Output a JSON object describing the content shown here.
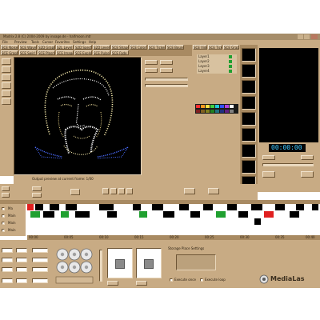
{
  "window": {
    "title": "Madrix 2.8 (C) 2004-2009 by inoage.de - halfmoon.mtr"
  },
  "menu": [
    "File",
    "Preview",
    "Tools",
    "Cursor",
    "Favorites",
    "Settings",
    "Help"
  ],
  "effect_tabs": [
    "SCE Noise",
    "SCE Wave",
    "S2D Graph",
    "S2L Level",
    "S2D Spectrum",
    "S2D Level",
    "SCE Shapes",
    "SCE Color",
    "SCE Ticker",
    "SCE Bounce",
    "SCE Graphic",
    "SCE Swirl",
    "SCE Plasma",
    "SCE Image",
    "SCE Explosion",
    "SCE Pulse",
    "SCE Fade"
  ],
  "preview": {
    "status": "Output preview at current frame: 1/00"
  },
  "layers": {
    "tabs": [
      "SCE Video",
      "SCE Ticker",
      "SCE Graphic"
    ],
    "items": [
      "Layer1",
      "Layer2",
      "Layer3",
      "Layer4"
    ]
  },
  "timecode": "00:00:00",
  "tree": [
    "Ma",
    "Main",
    "Main",
    "Main"
  ],
  "time_marks": [
    "00:00",
    "00:05",
    "00:10",
    "00:15",
    "00:20",
    "00:25",
    "00:30",
    "00:35",
    "00:40"
  ],
  "storage": {
    "label": "Storage Place Settings",
    "options": [
      "Execute once",
      "Execute loop"
    ]
  },
  "logo": "MediaLas",
  "colors": {
    "tan": "#c8ab84",
    "dark": "#1a1a1a",
    "digits": "#3ec8ff",
    "red": "#e02020",
    "green": "#20a030"
  }
}
